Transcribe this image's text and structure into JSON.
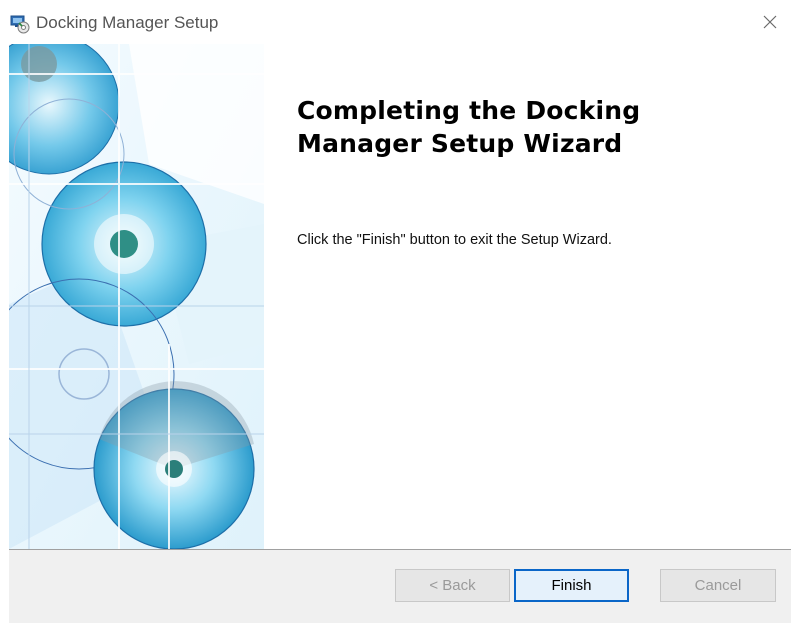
{
  "window": {
    "title": "Docking Manager Setup",
    "app_icon": "installer-icon",
    "close_icon": "close-icon"
  },
  "main": {
    "heading": "Completing the Docking Manager Setup Wizard",
    "body": "Click the \"Finish\" button to exit the Setup Wizard."
  },
  "buttons": {
    "back_label": "< Back",
    "back_enabled": false,
    "finish_label": "Finish",
    "finish_default": true,
    "cancel_label": "Cancel",
    "cancel_enabled": false
  },
  "colors": {
    "accent": "#0a66c8",
    "banner_primary": "#5bc2e7",
    "footer_bg": "#f0f0f0"
  }
}
